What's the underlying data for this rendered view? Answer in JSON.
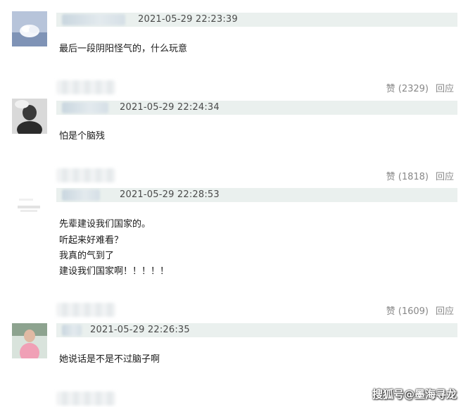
{
  "comments": [
    {
      "timestamp": "2021-05-29 22:23:39",
      "lines": [
        "最后一段阴阳怪气的，什么玩意"
      ],
      "likes": "赞 (2329)",
      "reply": "回应"
    },
    {
      "timestamp": "2021-05-29 22:24:34",
      "lines": [
        "怕是个脑残"
      ],
      "likes": "赞 (1818)",
      "reply": "回应"
    },
    {
      "timestamp": "2021-05-29 22:28:53",
      "lines": [
        "先辈建设我们国家的。",
        "听起来好难看？",
        "我真的气到了",
        "建设我们国家啊！！！！！"
      ],
      "likes": "赞 (1609)",
      "reply": "回应"
    },
    {
      "timestamp": "2021-05-29 22:26:35",
      "lines": [
        "她说话是不是不过脑子啊"
      ]
    }
  ],
  "watermark": "搜狐号@墨海寻龙"
}
